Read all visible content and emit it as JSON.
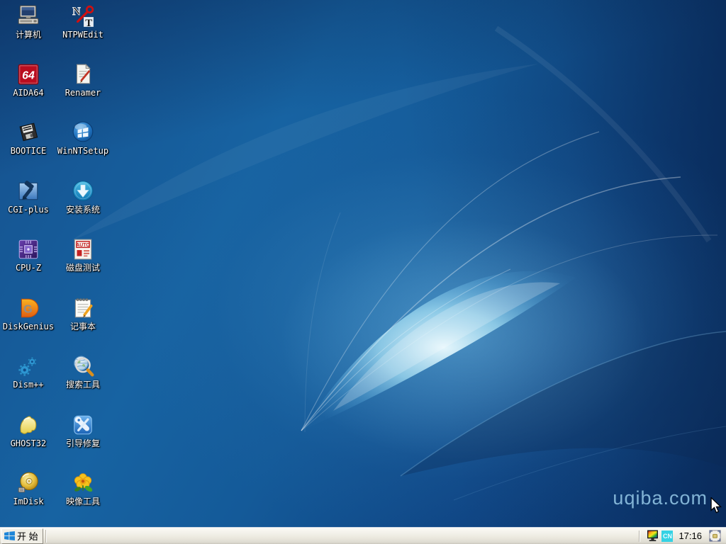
{
  "desktop": {
    "watermark": "uqiba.com",
    "icons": [
      {
        "name": "computer",
        "label": "计算机"
      },
      {
        "name": "ntpwedit",
        "label": "NTPWEdit"
      },
      {
        "name": "aida64",
        "label": "AIDA64"
      },
      {
        "name": "renamer",
        "label": "Renamer"
      },
      {
        "name": "bootice",
        "label": "BOOTICE"
      },
      {
        "name": "winntsetup",
        "label": "WinNTSetup"
      },
      {
        "name": "cgi-plus",
        "label": "CGI-plus"
      },
      {
        "name": "install-system",
        "label": "安装系统"
      },
      {
        "name": "cpu-z",
        "label": "CPU-Z"
      },
      {
        "name": "disk-test",
        "label": "磁盘测试"
      },
      {
        "name": "diskgenius",
        "label": "DiskGenius"
      },
      {
        "name": "notepad",
        "label": "记事本"
      },
      {
        "name": "dism",
        "label": "Dism++"
      },
      {
        "name": "search-tool",
        "label": "搜索工具"
      },
      {
        "name": "ghost32",
        "label": "GHOST32"
      },
      {
        "name": "boot-repair",
        "label": "引导修复"
      },
      {
        "name": "imdisk",
        "label": "ImDisk"
      },
      {
        "name": "image-tool",
        "label": "映像工具"
      }
    ],
    "icon_texts": {
      "aida64": "64",
      "disk_test": "AUTO",
      "diskgenius": "G",
      "ntpwedit_n": "N",
      "ntpwedit_t": "T"
    }
  },
  "taskbar": {
    "start_label": "开 始",
    "tray": {
      "input_indicator": "CN",
      "time": "17:16"
    }
  },
  "colors": {
    "desktop_blue": "#11508f",
    "taskbar_bg": "#edebe1",
    "watermark_color": "#8fc2e2",
    "cn_badge": "#35d2e4",
    "start_logo_blue": "#1e86d8"
  }
}
